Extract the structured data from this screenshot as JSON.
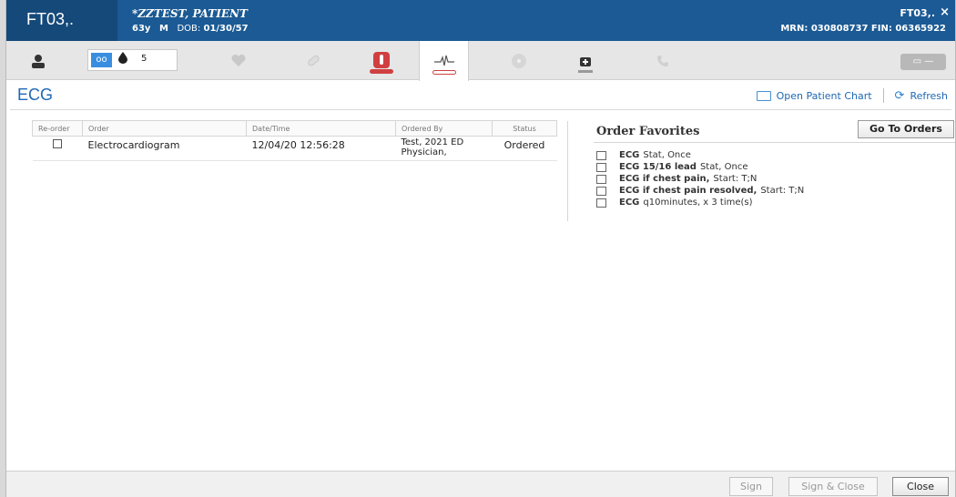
{
  "header": {
    "unit": "FT03,.",
    "patient_name": "*ZZTEST, PATIENT",
    "age": "63y",
    "sex": "M",
    "dob_label": "DOB:",
    "dob": "01/30/57",
    "right_unit": "FT03,.",
    "close": "×",
    "mrn_fin": "MRN: 030808737  FIN: 06365922"
  },
  "toolbar": {
    "count": "5",
    "active_tab": "ecg"
  },
  "page": {
    "title": "ECG",
    "open_chart": "Open Patient Chart",
    "refresh": "Refresh"
  },
  "table": {
    "headers": [
      "Re-order",
      "Order",
      "Date/Time",
      "Ordered By",
      "Status"
    ],
    "rows": [
      {
        "order": "Electrocardiogram",
        "datetime": "12/04/20 12:56:28",
        "ordered_by_line1": "Test, 2021 ED",
        "ordered_by_line2": "Physician,",
        "status": "Ordered"
      }
    ]
  },
  "favorites": {
    "title": "Order Favorites",
    "go_button": "Go To Orders",
    "items": [
      {
        "bold": "ECG",
        "rest": "Stat, Once"
      },
      {
        "bold": "ECG 15/16 lead",
        "rest": "Stat, Once"
      },
      {
        "bold": "ECG if chest pain,",
        "rest": "Start: T;N"
      },
      {
        "bold": "ECG if chest pain resolved,",
        "rest": "Start: T;N"
      },
      {
        "bold": "ECG",
        "rest": "q10minutes, x 3 time(s)"
      }
    ]
  },
  "footer": {
    "sign": "Sign",
    "sign_close": "Sign & Close",
    "close": "Close"
  },
  "colors": {
    "header_bg": "#1b5a94",
    "accent_blue": "#1f68b4",
    "alert_red": "#d04040"
  }
}
